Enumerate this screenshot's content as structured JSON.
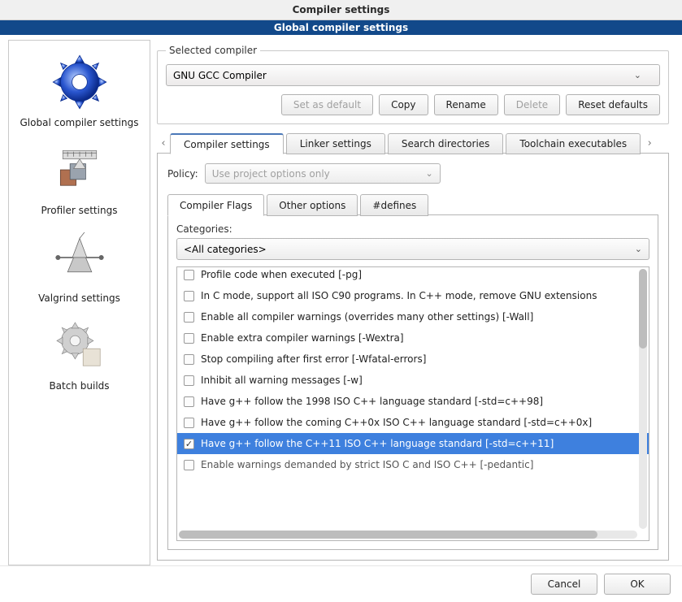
{
  "window_title": "Compiler settings",
  "banner_title": "Global compiler settings",
  "sidebar": {
    "items": [
      {
        "label": "Global compiler settings"
      },
      {
        "label": "Profiler settings"
      },
      {
        "label": "Valgrind settings"
      },
      {
        "label": "Batch builds"
      }
    ]
  },
  "selected_compiler": {
    "legend": "Selected compiler",
    "value": "GNU GCC Compiler",
    "buttons": {
      "set_default": "Set as default",
      "copy": "Copy",
      "rename": "Rename",
      "delete": "Delete",
      "reset": "Reset defaults"
    }
  },
  "main_tabs": [
    {
      "label": "Compiler settings"
    },
    {
      "label": "Linker settings"
    },
    {
      "label": "Search directories"
    },
    {
      "label": "Toolchain executables"
    }
  ],
  "policy": {
    "label": "Policy:",
    "value": "Use project options only"
  },
  "sub_tabs": [
    {
      "label": "Compiler Flags"
    },
    {
      "label": "Other options"
    },
    {
      "label": "#defines"
    }
  ],
  "categories": {
    "label": "Categories:",
    "value": "<All categories>"
  },
  "flags": [
    {
      "label": "Profile code when executed  [-pg]",
      "checked": false
    },
    {
      "label": "In C mode, support all ISO C90 programs. In C++ mode, remove GNU extensions",
      "checked": false
    },
    {
      "label": "Enable all compiler warnings (overrides many other settings)  [-Wall]",
      "checked": false
    },
    {
      "label": "Enable extra compiler warnings  [-Wextra]",
      "checked": false
    },
    {
      "label": "Stop compiling after first error  [-Wfatal-errors]",
      "checked": false
    },
    {
      "label": "Inhibit all warning messages  [-w]",
      "checked": false
    },
    {
      "label": "Have g++ follow the 1998 ISO C++ language standard  [-std=c++98]",
      "checked": false
    },
    {
      "label": "Have g++ follow the coming C++0x ISO C++ language standard  [-std=c++0x]",
      "checked": false
    },
    {
      "label": "Have g++ follow the C++11 ISO C++ language standard  [-std=c++11]",
      "checked": true
    },
    {
      "label": "Enable warnings demanded by strict ISO C and ISO C++  [-pedantic]",
      "checked": false
    }
  ],
  "footer": {
    "cancel": "Cancel",
    "ok": "OK"
  }
}
